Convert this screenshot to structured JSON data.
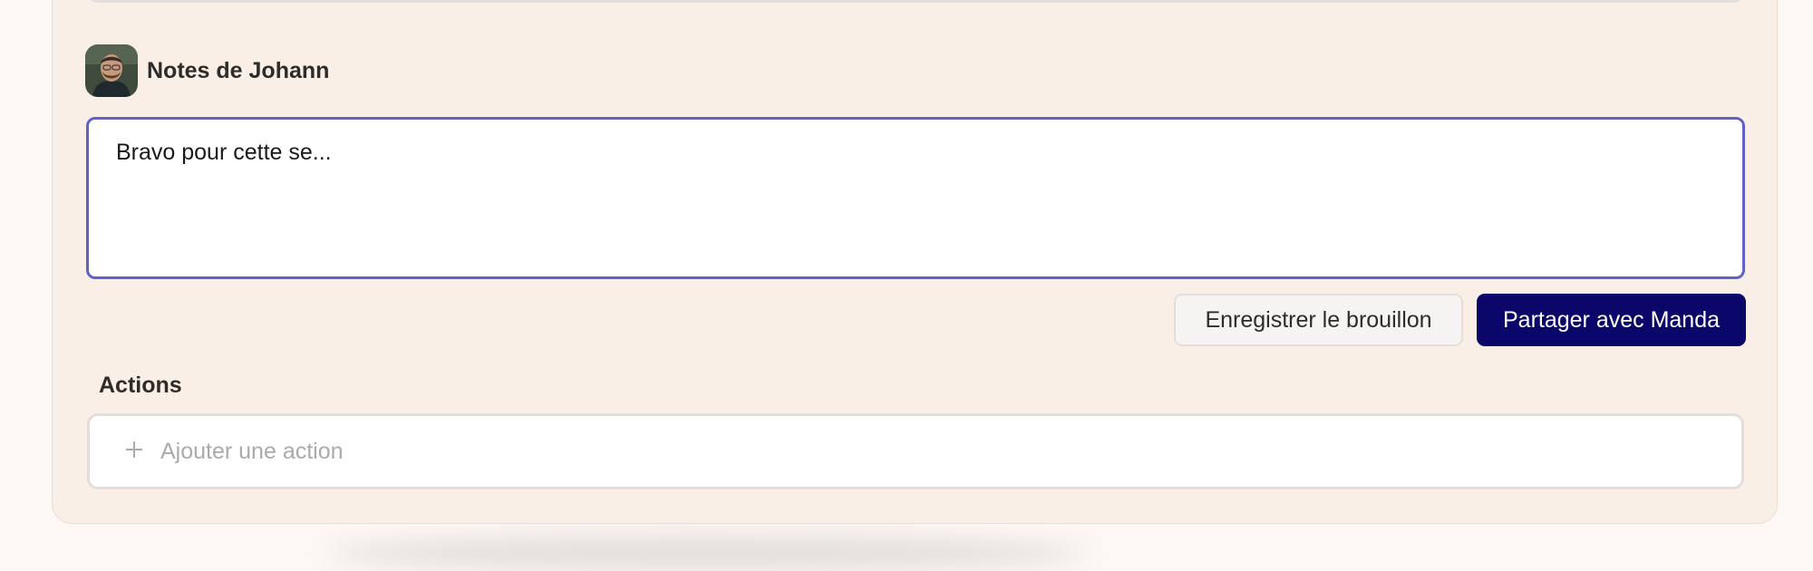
{
  "notes": {
    "title": "Notes de Johann",
    "avatar_icon": "person-avatar",
    "text": "Bravo pour cette se..."
  },
  "buttons": {
    "save_draft": "Enregistrer le brouillon",
    "share": "Partager avec Manda"
  },
  "actions": {
    "title": "Actions",
    "add_icon": "plus-icon",
    "add_placeholder": "Ajouter une action"
  },
  "colors": {
    "panel_background": "#f9efe6",
    "focus_border": "#5f63c9",
    "primary_button": "#0b0669"
  }
}
